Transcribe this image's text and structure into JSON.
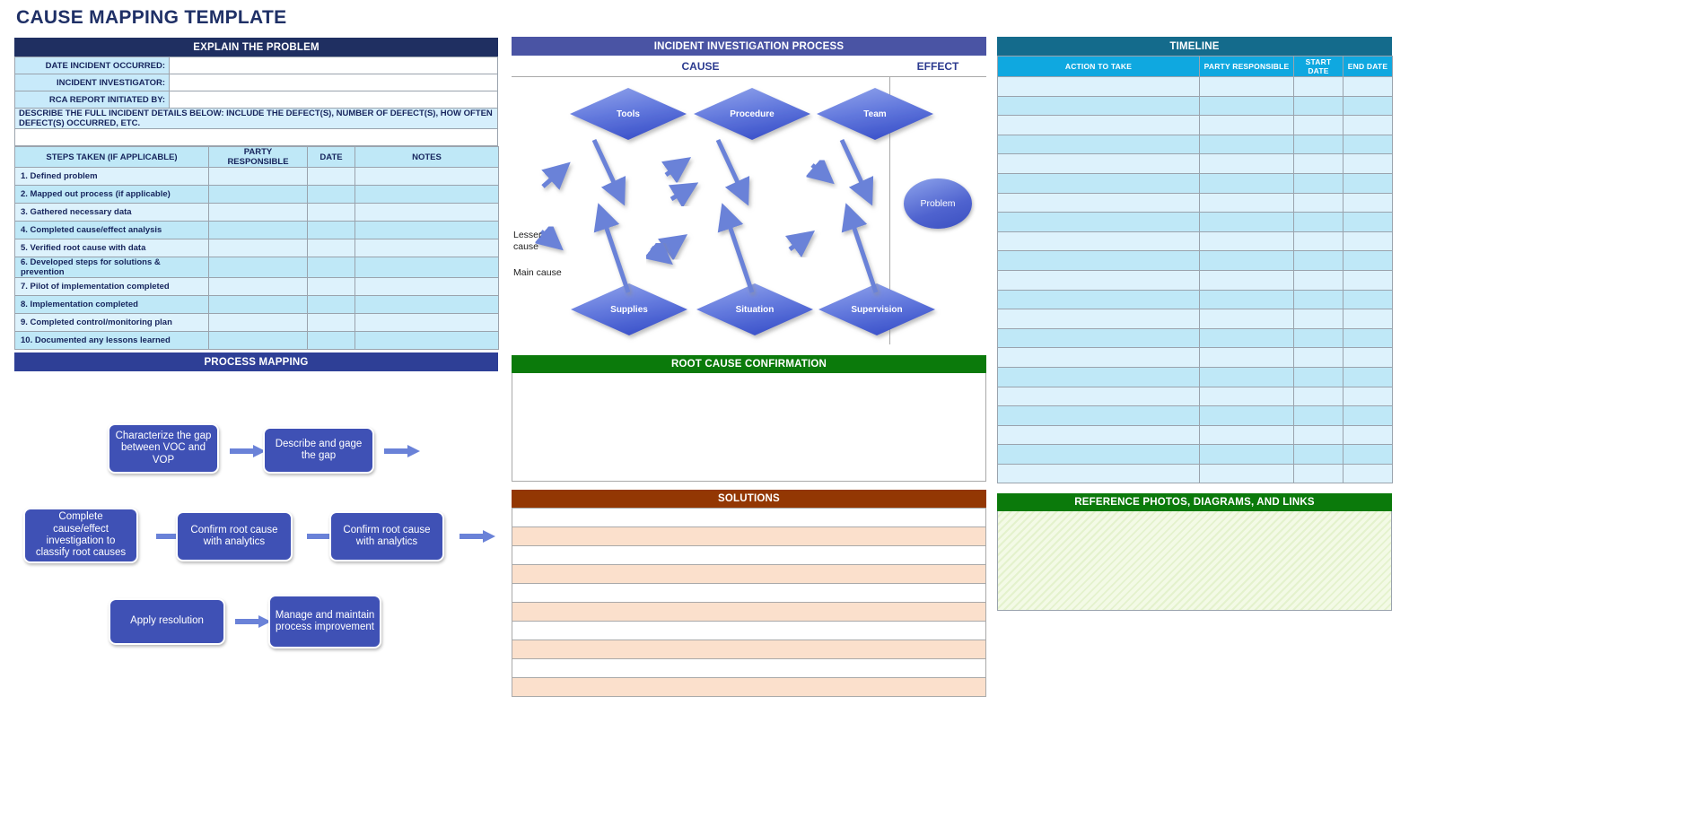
{
  "title": "CAUSE MAPPING TEMPLATE",
  "colors": {
    "navy_header": "#1f2f61",
    "process_header": "#2e3f96",
    "incident_header": "#4a54a4",
    "timeline_header": "#146b8c",
    "timeline_subheader": "#0fa8e0",
    "green_header": "#0b7a0b",
    "solutions_header": "#933703",
    "box_blue": "#3f51b5",
    "row_light": "#ddf2fc",
    "row_dark": "#bfe8f7",
    "solutions_row": "#fbe0cc"
  },
  "explain": {
    "header": "EXPLAIN THE PROBLEM",
    "fields": [
      {
        "label": "DATE INCIDENT OCCURRED:",
        "value": ""
      },
      {
        "label": "INCIDENT INVESTIGATOR:",
        "value": ""
      },
      {
        "label": "RCA REPORT INITIATED BY:",
        "value": ""
      }
    ],
    "describe_label": "DESCRIBE THE FULL INCIDENT DETAILS BELOW: INCLUDE THE DEFECT(S), NUMBER OF DEFECT(S), HOW OFTEN DEFECT(S) OCCURRED, ETC.",
    "describe_value": ""
  },
  "steps_table": {
    "headers": [
      "STEPS TAKEN (IF APPLICABLE)",
      "PARTY RESPONSIBLE",
      "DATE",
      "NOTES"
    ],
    "rows": [
      {
        "step": "1. Defined problem",
        "party": "",
        "date": "",
        "notes": ""
      },
      {
        "step": "2. Mapped out process (if applicable)",
        "party": "",
        "date": "",
        "notes": ""
      },
      {
        "step": "3. Gathered necessary data",
        "party": "",
        "date": "",
        "notes": ""
      },
      {
        "step": "4. Completed cause/effect analysis",
        "party": "",
        "date": "",
        "notes": ""
      },
      {
        "step": "5. Verified root cause with data",
        "party": "",
        "date": "",
        "notes": ""
      },
      {
        "step": "6. Developed steps for solutions & prevention",
        "party": "",
        "date": "",
        "notes": ""
      },
      {
        "step": "7. Pilot of implementation completed",
        "party": "",
        "date": "",
        "notes": ""
      },
      {
        "step": "8. Implementation completed",
        "party": "",
        "date": "",
        "notes": ""
      },
      {
        "step": "9. Completed control/monitoring plan",
        "party": "",
        "date": "",
        "notes": ""
      },
      {
        "step": "10. Documented any lessons learned",
        "party": "",
        "date": "",
        "notes": ""
      }
    ]
  },
  "process_mapping": {
    "header": "PROCESS MAPPING",
    "boxes": [
      {
        "label": "Characterize the gap between VOC and VOP"
      },
      {
        "label": "Describe and gage the gap"
      },
      {
        "label": "Complete cause/effect investigation to classify root causes"
      },
      {
        "label": "Confirm root cause with analytics"
      },
      {
        "label": "Confirm root cause with analytics"
      },
      {
        "label": "Apply resolution"
      },
      {
        "label": "Manage and maintain process improvement"
      }
    ]
  },
  "incident_investigation": {
    "header": "INCIDENT INVESTIGATION PROCESS",
    "cause_label": "CAUSE",
    "effect_label": "EFFECT",
    "top_categories": [
      "Tools",
      "Procedure",
      "Team"
    ],
    "bottom_categories": [
      "Supplies",
      "Situation",
      "Supervision"
    ],
    "effect_node": "Problem",
    "annotations": [
      "Lesser",
      "cause",
      "Main cause"
    ]
  },
  "root_cause_confirmation": {
    "header": "ROOT CAUSE CONFIRMATION",
    "body": ""
  },
  "solutions": {
    "header": "SOLUTIONS",
    "rows": [
      "",
      "",
      "",
      "",
      "",
      "",
      "",
      "",
      "",
      ""
    ]
  },
  "timeline": {
    "header": "TIMELINE",
    "columns": [
      "ACTION TO TAKE",
      "PARTY RESPONSIBLE",
      "START DATE",
      "END DATE"
    ],
    "rows": [
      {
        "action": "",
        "party": "",
        "start": "",
        "end": ""
      },
      {
        "action": "",
        "party": "",
        "start": "",
        "end": ""
      },
      {
        "action": "",
        "party": "",
        "start": "",
        "end": ""
      },
      {
        "action": "",
        "party": "",
        "start": "",
        "end": ""
      },
      {
        "action": "",
        "party": "",
        "start": "",
        "end": ""
      },
      {
        "action": "",
        "party": "",
        "start": "",
        "end": ""
      },
      {
        "action": "",
        "party": "",
        "start": "",
        "end": ""
      },
      {
        "action": "",
        "party": "",
        "start": "",
        "end": ""
      },
      {
        "action": "",
        "party": "",
        "start": "",
        "end": ""
      },
      {
        "action": "",
        "party": "",
        "start": "",
        "end": ""
      },
      {
        "action": "",
        "party": "",
        "start": "",
        "end": ""
      },
      {
        "action": "",
        "party": "",
        "start": "",
        "end": ""
      },
      {
        "action": "",
        "party": "",
        "start": "",
        "end": ""
      },
      {
        "action": "",
        "party": "",
        "start": "",
        "end": ""
      },
      {
        "action": "",
        "party": "",
        "start": "",
        "end": ""
      },
      {
        "action": "",
        "party": "",
        "start": "",
        "end": ""
      },
      {
        "action": "",
        "party": "",
        "start": "",
        "end": ""
      },
      {
        "action": "",
        "party": "",
        "start": "",
        "end": ""
      },
      {
        "action": "",
        "party": "",
        "start": "",
        "end": ""
      },
      {
        "action": "",
        "party": "",
        "start": "",
        "end": ""
      },
      {
        "action": "",
        "party": "",
        "start": "",
        "end": ""
      }
    ]
  },
  "reference": {
    "header": "REFERENCE PHOTOS, DIAGRAMS, AND LINKS",
    "body": ""
  }
}
